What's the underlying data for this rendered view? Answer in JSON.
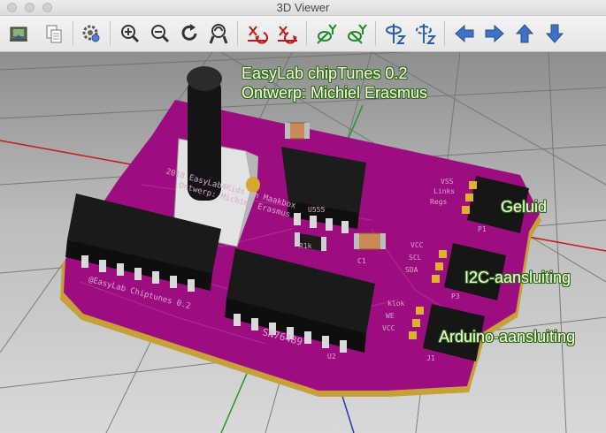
{
  "window": {
    "title": "3D Viewer"
  },
  "toolbar": {
    "buttons": [
      {
        "icon": "export-icon"
      },
      {
        "icon": "copy-icon"
      },
      {
        "icon": "settings-icon"
      },
      {
        "icon": "zoom-in-icon"
      },
      {
        "icon": "zoom-out-icon"
      },
      {
        "icon": "redraw-icon"
      },
      {
        "icon": "zoom-fit-icon"
      },
      {
        "icon": "rotate-x-cw-icon"
      },
      {
        "icon": "rotate-x-ccw-icon"
      },
      {
        "icon": "rotate-y-cw-icon"
      },
      {
        "icon": "rotate-y-ccw-icon"
      },
      {
        "icon": "rotate-z-cw-icon"
      },
      {
        "icon": "rotate-z-ccw-icon"
      },
      {
        "icon": "move-left-icon"
      },
      {
        "icon": "move-right-icon"
      },
      {
        "icon": "move-up-icon"
      },
      {
        "icon": "move-down-icon"
      }
    ]
  },
  "annotations": {
    "title_line1": "EasyLab chipTunes 0.2",
    "title_line2": "Ontwerp: Michiel Erasmus",
    "geluid": "Geluid",
    "i2c": "I2C-aansluiting",
    "arduino": "Arduino-aansluiting"
  },
  "pcb": {
    "silk_line1": "2018 EasyLab4Kids en Maakbox",
    "silk_line2": "Ontwerp: Michiel Erasmus",
    "silk_line3": "@EasyLab Chiptunes 0.2",
    "chip_label": "SN76489",
    "ic_ref": "U555",
    "r_label": "R1k",
    "vss": "VSS",
    "links": "Links",
    "regs": "Regs",
    "vcc1": "VCC",
    "scl": "SCL",
    "sda": "SDA",
    "klok": "klok",
    "we": "WE",
    "vcc2": "VCC",
    "p1": "P1",
    "p3": "P3",
    "j1": "J1",
    "c1": "C1",
    "u2": "U2"
  },
  "colors": {
    "board": "#9c0d7f",
    "board_edge": "#d4b046",
    "chip": "#1c1c1c",
    "annotation_outline": "#2d6b1a"
  }
}
